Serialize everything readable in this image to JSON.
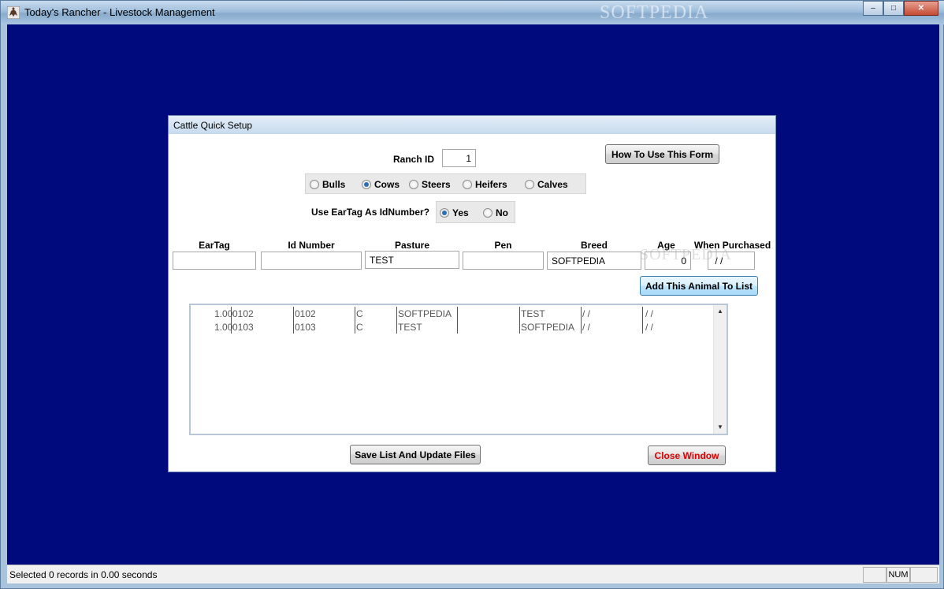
{
  "window": {
    "title": "Today's Rancher - Livestock Management",
    "watermark": "SOFTPEDIA",
    "controls": {
      "minimize": "–",
      "maximize": "□",
      "close": "✕"
    }
  },
  "dialog": {
    "title": "Cattle Quick Setup",
    "ranch_id_label": "Ranch ID",
    "ranch_id_value": "1",
    "how_to_button": "How To Use This Form",
    "animal_types": [
      {
        "label": "Bulls",
        "selected": false
      },
      {
        "label": "Cows",
        "selected": true
      },
      {
        "label": "Steers",
        "selected": false
      },
      {
        "label": "Heifers",
        "selected": false
      },
      {
        "label": "Calves",
        "selected": false
      }
    ],
    "eartag_question": "Use EarTag As IdNumber?",
    "eartag_options": [
      {
        "label": "Yes",
        "selected": true
      },
      {
        "label": "No",
        "selected": false
      }
    ],
    "columns": {
      "eartag": "EarTag",
      "id_number": "Id Number",
      "pasture": "Pasture",
      "pen": "Pen",
      "breed": "Breed",
      "age": "Age",
      "when_purchased": "When Purchased"
    },
    "inputs": {
      "eartag": "",
      "id_number": "",
      "pasture": "TEST",
      "pen": "",
      "breed": "SOFTPEDIA",
      "age": "0",
      "when_purchased": " / /"
    },
    "add_button": "Add This Animal To List",
    "list_rows": [
      {
        "c1": "1.00",
        "c2": "0102",
        "c3": "0102",
        "c4": "C",
        "c5": "SOFTPEDIA",
        "c6": "",
        "c7": "TEST",
        "c8": " / /",
        "c9": " / /"
      },
      {
        "c1": "1.00",
        "c2": "0103",
        "c3": "0103",
        "c4": "C",
        "c5": "TEST",
        "c6": "",
        "c7": "SOFTPEDIA",
        "c8": " / /",
        "c9": " / /"
      }
    ],
    "save_button": "Save List And Update Files",
    "close_button": "Close Window",
    "watermark": "SOFTPEDIA"
  },
  "statusbar": {
    "text": "Selected 0 records in 0.00 seconds",
    "num": "NUM"
  },
  "colors": {
    "workspace": "#000a7c",
    "close_text": "#e00000"
  }
}
